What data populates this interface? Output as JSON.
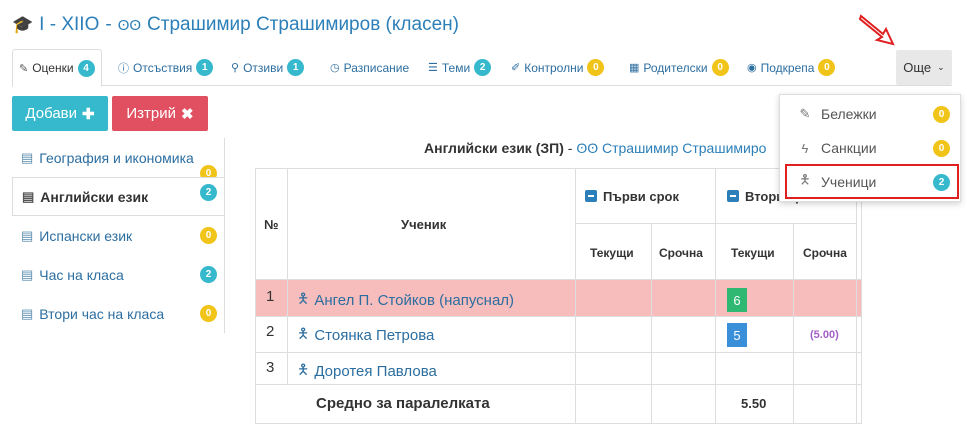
{
  "header": {
    "cap_icon": "graduation-cap-icon",
    "glasses_icon": "glasses-icon",
    "class_name": "I - XIIO",
    "teacher": "Страшимир Страшимиров (класен)"
  },
  "tabs": [
    {
      "icon": "pencil-icon",
      "label": "Оценки",
      "badge": "4",
      "badge_color": "#36b9cc"
    },
    {
      "icon": "info-circle-icon",
      "label": "Отсъствия",
      "badge": "1",
      "badge_color": "#36b9cc"
    },
    {
      "icon": "award-icon",
      "label": "Отзиви",
      "badge": "1",
      "badge_color": "#36b9cc"
    },
    {
      "icon": "clock-icon",
      "label": "Разписание",
      "badge": null
    },
    {
      "icon": "list-icon",
      "label": "Теми",
      "badge": "2",
      "badge_color": "#36b9cc"
    },
    {
      "icon": "edit-icon",
      "label": "Контролни",
      "badge": "0",
      "badge_color": "#f0c419"
    },
    {
      "icon": "calendar-icon",
      "label": "Родителски",
      "badge": "0",
      "badge_color": "#f0c419"
    },
    {
      "icon": "eye-icon",
      "label": "Подкрепа",
      "badge": "0",
      "badge_color": "#f0c419"
    }
  ],
  "more": {
    "label": "Още",
    "icon": "chevron-down-icon"
  },
  "actions": {
    "add_label": "Добави",
    "add_icon": "plus-icon",
    "delete_label": "Изтрий",
    "delete_icon": "times-icon"
  },
  "subjects": [
    {
      "label": "География и икономика",
      "badge": "0",
      "badge_color": "#f0c419"
    },
    {
      "label": "Английски език",
      "badge": "2",
      "badge_color": "#36b9cc"
    },
    {
      "label": "Испански език",
      "badge": "0",
      "badge_color": "#f0c419"
    },
    {
      "label": "Час на класа",
      "badge": "2",
      "badge_color": "#36b9cc"
    },
    {
      "label": "Втори час на класа",
      "badge": "0",
      "badge_color": "#f0c419"
    }
  ],
  "subject_title": {
    "name": "Английски език (ЗП)",
    "separator": "-",
    "teacher": "Страшимир Страшимиро"
  },
  "table": {
    "col_num": "№",
    "col_student": "Ученик",
    "term1": "Първи срок",
    "term2": "Втори срок",
    "current": "Текущи",
    "final": "Срочна",
    "rows": [
      {
        "num": "1",
        "name": "Ангел П. Стойков (напуснал)",
        "highlight": true,
        "term2_current": "6",
        "term2_final": ""
      },
      {
        "num": "2",
        "name": "Стоянка Петрова",
        "highlight": false,
        "term2_current": "5",
        "term2_final": "(5.00)"
      },
      {
        "num": "3",
        "name": "Доротея Павлова",
        "highlight": false,
        "term2_current": "",
        "term2_final": ""
      }
    ],
    "average_label": "Средно за паралелката",
    "average_value": "5.50"
  },
  "dropdown": [
    {
      "icon": "note-icon",
      "label": "Бележки",
      "badge": "0",
      "badge_color": "#f0c419"
    },
    {
      "icon": "bolt-icon",
      "label": "Санкции",
      "badge": "0",
      "badge_color": "#f0c419"
    },
    {
      "icon": "student-icon",
      "label": "Ученици",
      "badge": "2",
      "badge_color": "#36b9cc"
    }
  ]
}
